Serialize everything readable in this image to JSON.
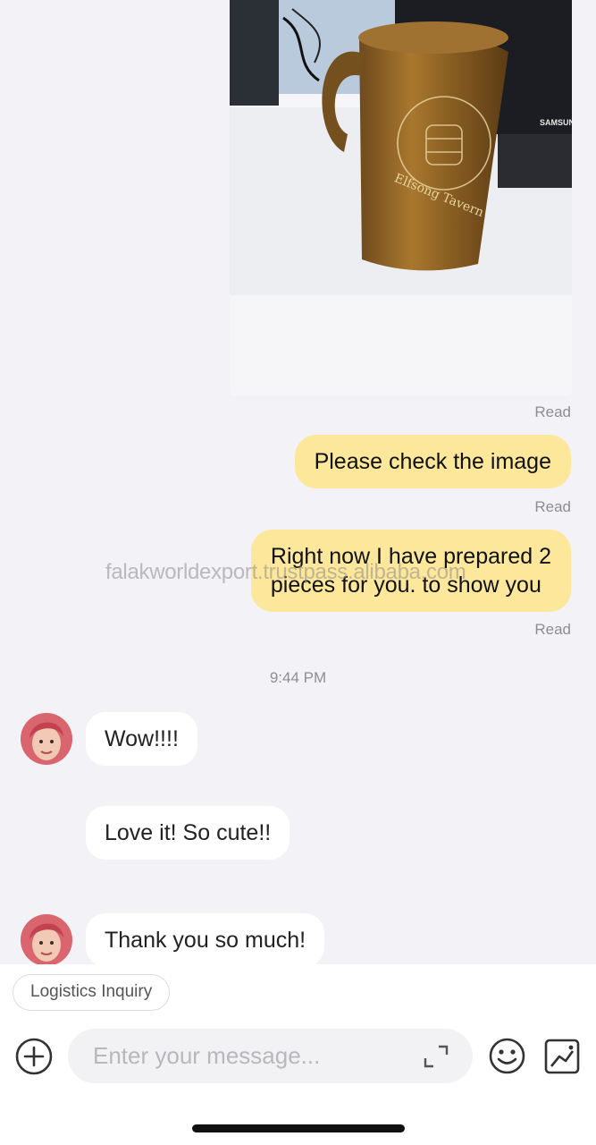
{
  "messages": {
    "image_status": "Read",
    "msg1": {
      "text": "Please check the image",
      "status": "Read"
    },
    "msg2": {
      "line1": "Right now I have prepared 2",
      "line2": "pieces for you. to show you",
      "status": "Read"
    },
    "timestamp": "9:44 PM",
    "in1": "Wow!!!!",
    "in2": "Love it! So cute!!",
    "in3": "Thank you so much!"
  },
  "watermark": "falakworldexport.trustpass.alibaba.com",
  "image": {
    "monitor_brand": "SAMSUNG",
    "engraving": "Elfsong Tavern"
  },
  "composer": {
    "chip_label": "Logistics Inquiry",
    "input_placeholder": "Enter your message..."
  },
  "colors": {
    "outgoing_bubble": "#fde79a",
    "incoming_bubble": "#ffffff",
    "background": "#f2f2f7"
  },
  "icons": {
    "add": "plus-circle-icon",
    "expand": "expand-icon",
    "emoji": "smiley-icon",
    "image": "image-icon"
  }
}
